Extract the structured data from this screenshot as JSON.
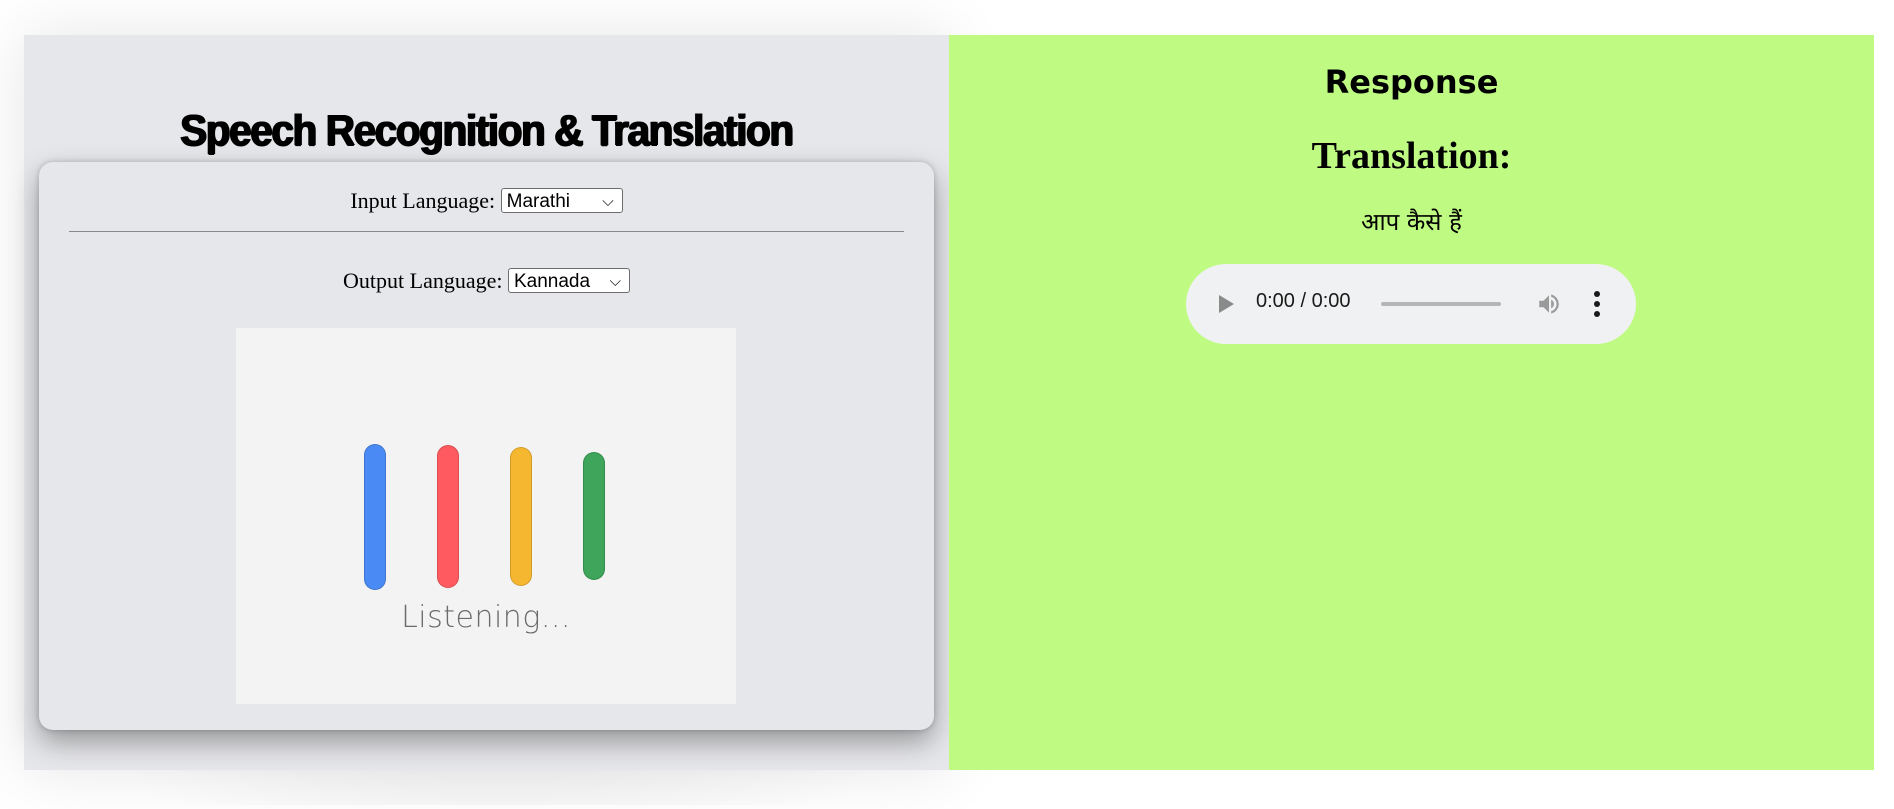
{
  "left": {
    "title": "Speech Recognition & Translation",
    "input_language": {
      "label": "Input Language:",
      "selected": "Marathi"
    },
    "output_language": {
      "label": "Output Language:",
      "selected": "Kannada"
    },
    "listening": {
      "text": "Listening...",
      "bar_colors": [
        "#4a8af4",
        "#ff5a5f",
        "#f6b730",
        "#3ea55a"
      ]
    },
    "colors": {
      "panel_bg": "#e6e7ea"
    }
  },
  "right": {
    "title": "Response",
    "translation_heading": "Translation:",
    "translation_text": "आप कैसे हैं",
    "audio": {
      "time": "0:00 / 0:00"
    },
    "colors": {
      "panel_bg": "#bffb82"
    }
  }
}
